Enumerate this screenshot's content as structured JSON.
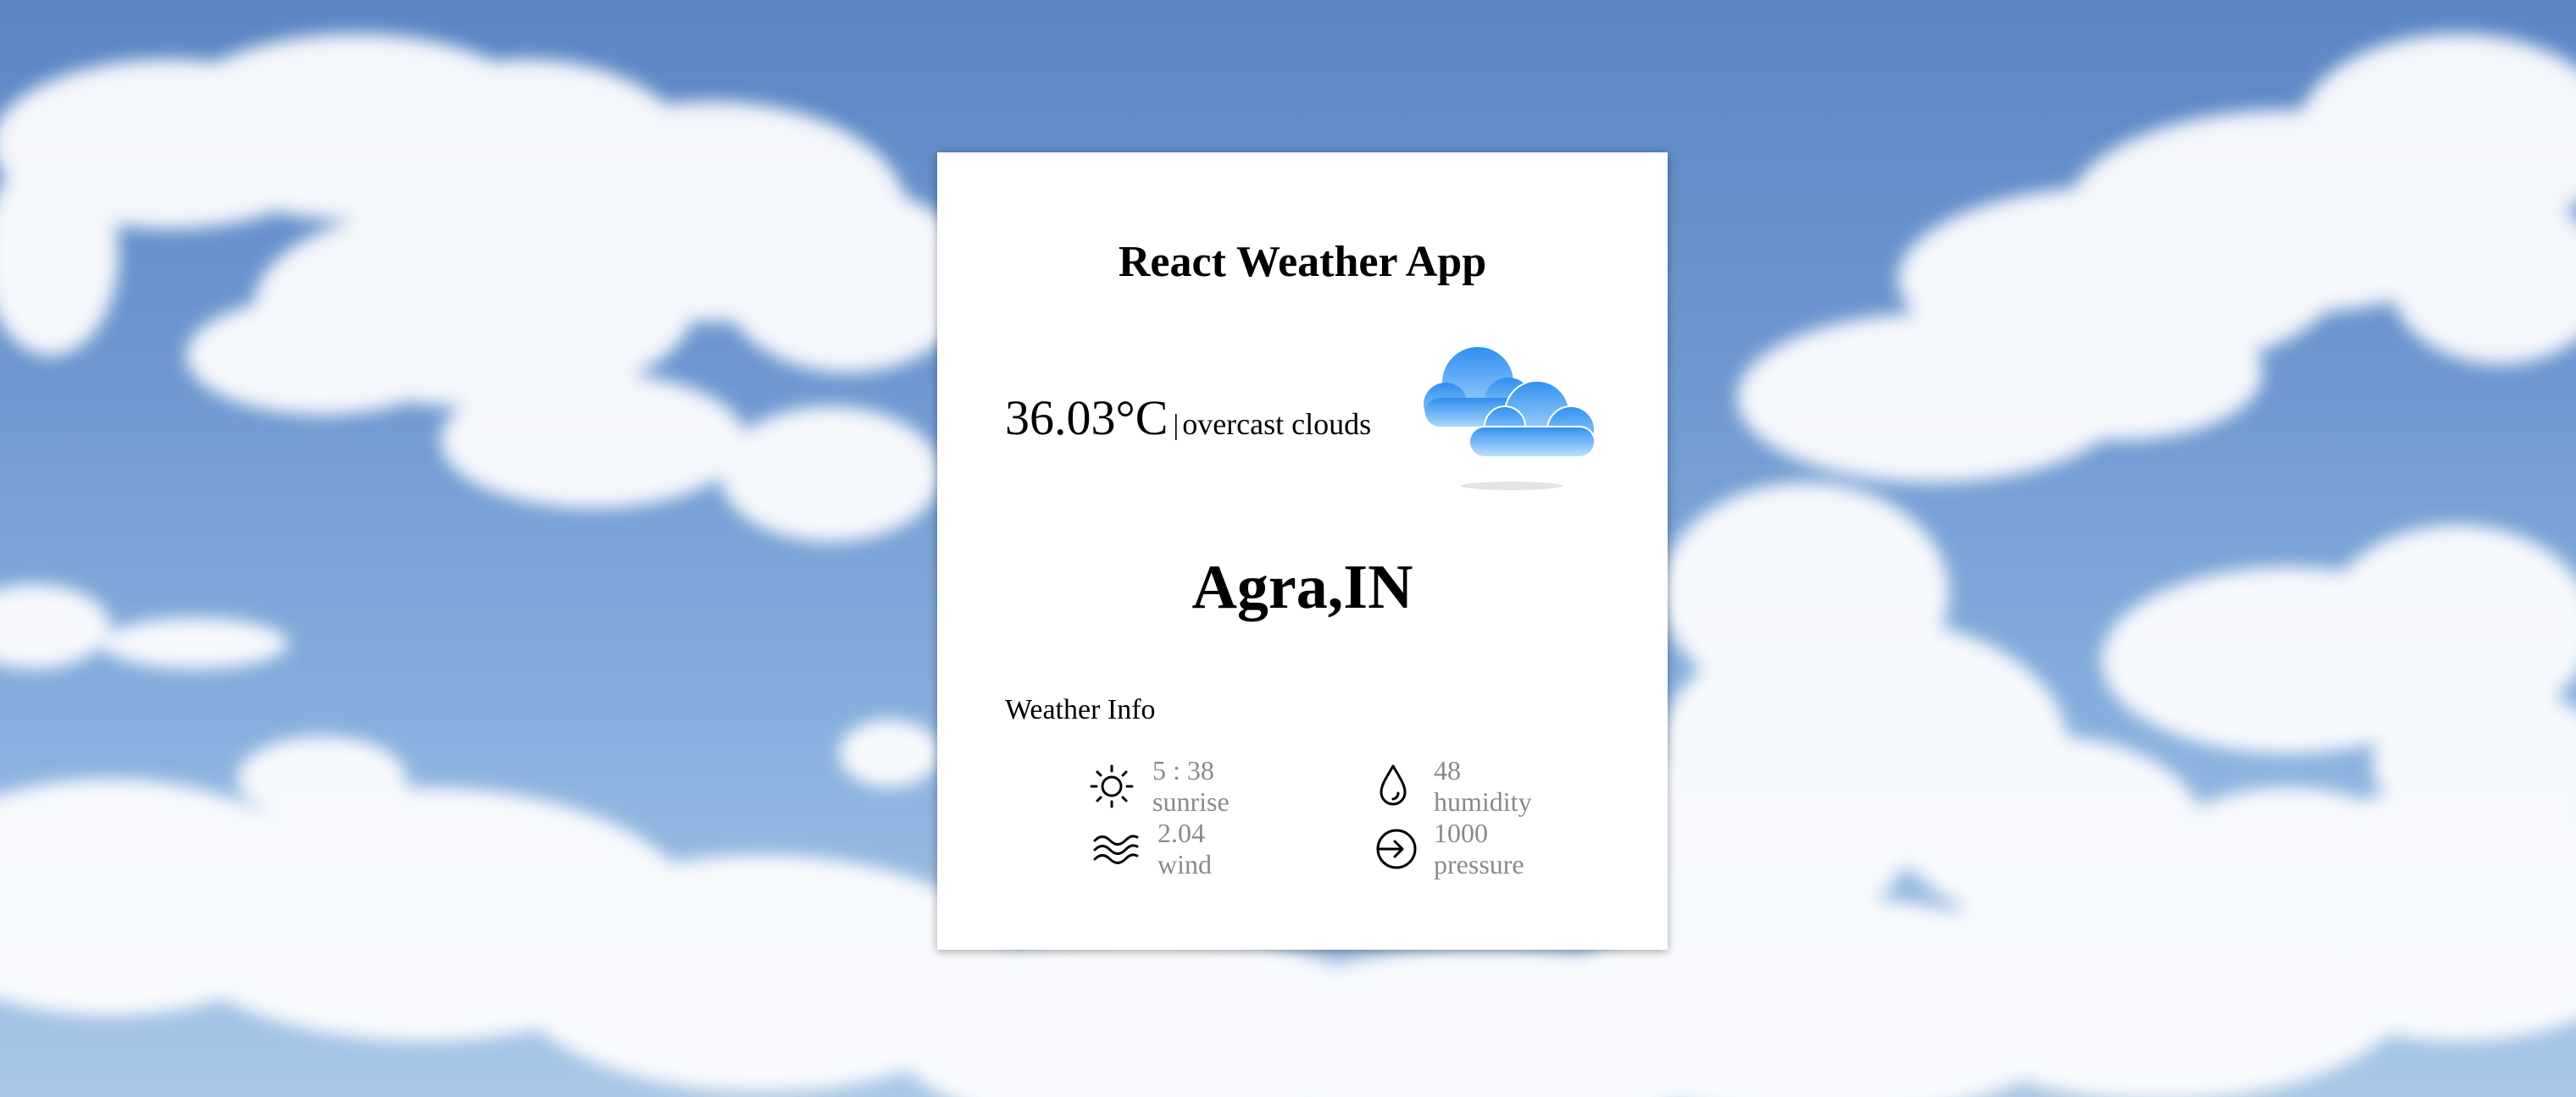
{
  "app": {
    "title": "React Weather App"
  },
  "current": {
    "temperature": "36.03°C",
    "separator": "|",
    "condition": "overcast clouds",
    "icon": "cloud-icon"
  },
  "location": {
    "city": "Agra,IN"
  },
  "info": {
    "label": "Weather Info",
    "sunrise": {
      "value": "5 : 38",
      "label": "sunrise",
      "icon": "sun-icon"
    },
    "humidity": {
      "value": "48",
      "label": "humidity",
      "icon": "droplet-icon"
    },
    "wind": {
      "value": "2.04",
      "label": "wind",
      "icon": "wind-icon"
    },
    "pressure": {
      "value": "1000",
      "label": "pressure",
      "icon": "pressure-icon"
    }
  },
  "colors": {
    "sky": "#6f98d0",
    "card": "#ffffff",
    "muted_text": "#8a8a8a",
    "cloud_icon": "#4aa3f5"
  }
}
